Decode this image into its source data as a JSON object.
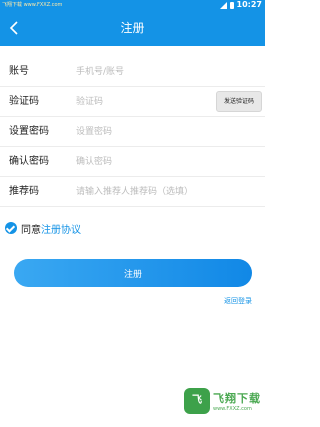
{
  "status_bar": {
    "source_text": "飞翔下载 www.FXXZ.com",
    "time": "10:27"
  },
  "titlebar": {
    "title": "注册"
  },
  "form": {
    "rows": [
      {
        "label": "账号",
        "placeholder": "手机号/账号"
      },
      {
        "label": "验证码",
        "placeholder": "验证码"
      },
      {
        "label": "设置密码",
        "placeholder": "设置密码"
      },
      {
        "label": "确认密码",
        "placeholder": "确认密码"
      },
      {
        "label": "推荐码",
        "placeholder": "请输入推荐人推荐码（选填）"
      }
    ],
    "send_code_label": "发送验证码"
  },
  "agreement": {
    "prefix": "同意",
    "link": "注册协议",
    "checked": true
  },
  "submit_label": "注册",
  "back_login_label": "返回登录",
  "watermark": {
    "name": "飞翔下载",
    "url": "www.FXXZ.com"
  },
  "colors": {
    "accent": "#1493e6"
  }
}
